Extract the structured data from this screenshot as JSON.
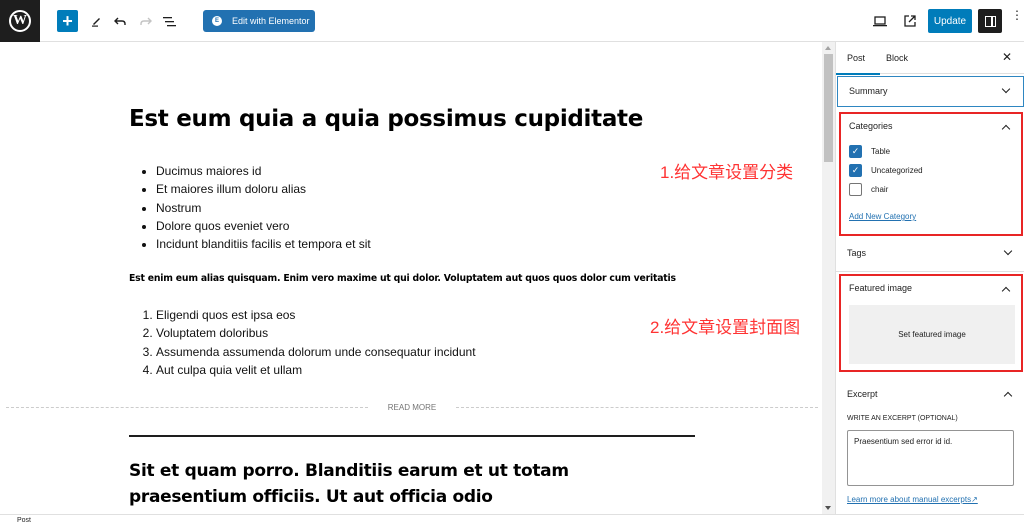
{
  "toolbar": {
    "logo": "W",
    "add_icon": "+",
    "tools_icon": "pencil-icon",
    "undo_icon": "undo-icon",
    "redo_icon": "redo-icon",
    "list_view_icon": "list-view-icon",
    "elementor_label": "Edit with Elementor",
    "elementor_icon": "E",
    "preview_icon": "desktop-icon",
    "view_post_icon": "external-link-icon",
    "update_label": "Update",
    "settings_icon": "sidebar-icon",
    "more_icon": "⋮",
    "colors": {
      "primary": "#007cba",
      "elementor": "#2271b1",
      "dark": "#1e1e1e"
    }
  },
  "editor": {
    "title": "Est eum quia a quia possimus cupiditate",
    "bullets": [
      "Ducimus maiores id",
      "Et maiores illum doloru alias",
      "Nostrum",
      "Dolore quos eveniet vero",
      "Incidunt blanditiis facilis et tempora et sit"
    ],
    "bold_paragraph": "Est enim eum alias quisquam. Enim vero maxime ut qui dolor. Voluptatem aut quos quos dolor cum veritatis",
    "ordered": [
      "Eligendi quos est ipsa eos",
      "Voluptatem doloribus",
      "Assumenda assumenda dolorum unde consequatur incidunt",
      "Aut culpa quia velit et ullam"
    ],
    "read_more": "READ MORE",
    "heading2": "Sit et quam porro. Blanditiis earum et ut totam praesentium officiis. Ut aut officia odio"
  },
  "annotations": {
    "step1": "1.给文章设置分类",
    "step2": "2.给文章设置封面图",
    "color": "#ff3333"
  },
  "sidebar": {
    "tabs": {
      "post": "Post",
      "block": "Block"
    },
    "close": "✕",
    "summary": "Summary",
    "categories": {
      "title": "Categories",
      "items": [
        {
          "label": "Table",
          "checked": true
        },
        {
          "label": "Uncategorized",
          "checked": true
        },
        {
          "label": "chair",
          "checked": false
        }
      ],
      "add_new": "Add New Category"
    },
    "tags": "Tags",
    "featured_image": {
      "title": "Featured image",
      "button": "Set featured image"
    },
    "excerpt": {
      "title": "Excerpt",
      "label": "WRITE AN EXCERPT (OPTIONAL)",
      "value": "Praesentium sed error id id.",
      "learn_more": "Learn more about manual excerpts↗"
    }
  },
  "statusbar": {
    "breadcrumb": "Post"
  }
}
